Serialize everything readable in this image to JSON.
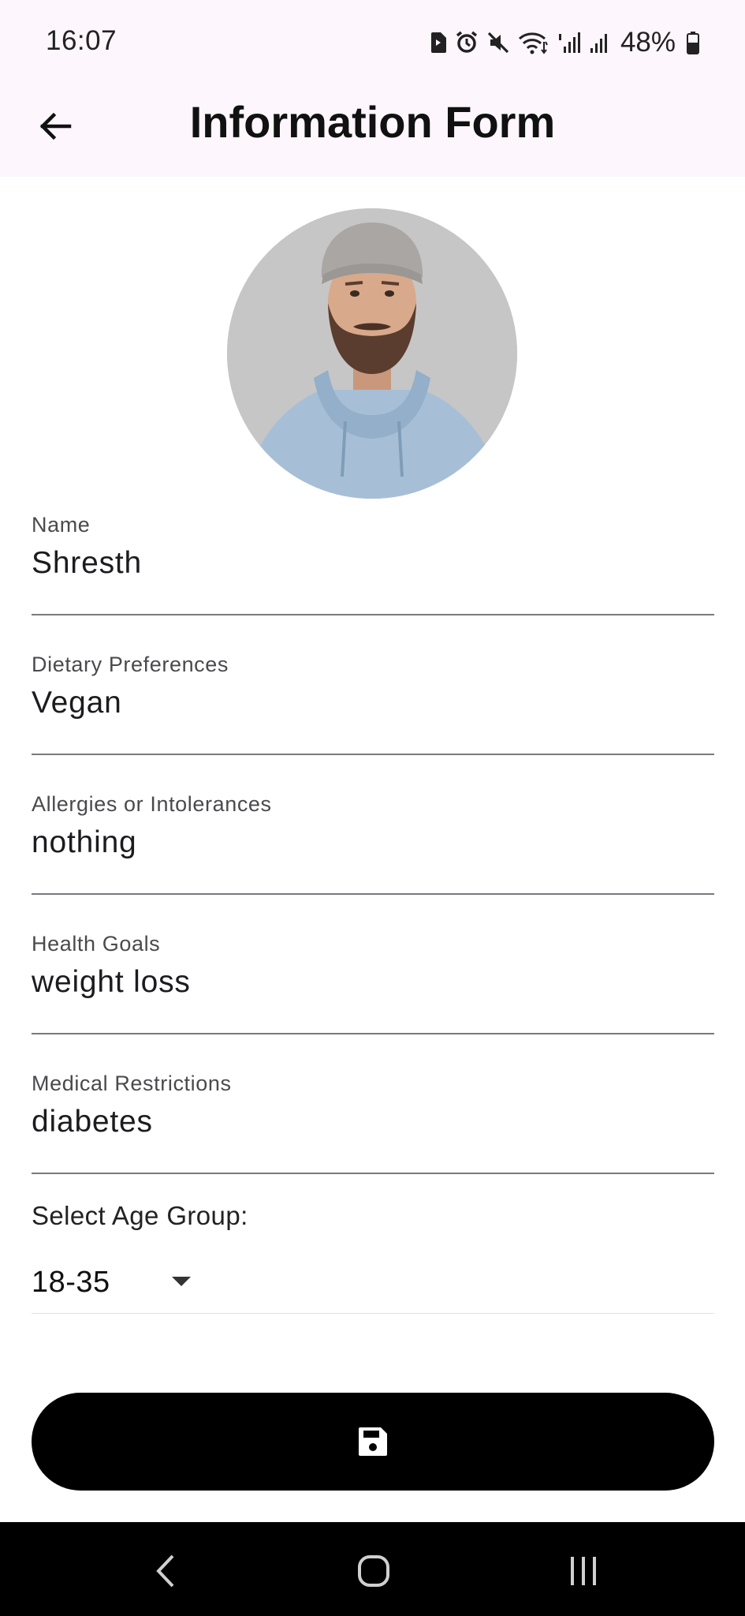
{
  "status_bar": {
    "time": "16:07",
    "battery": "48%",
    "icons": [
      "sim-icon",
      "alarm-icon",
      "mute-icon",
      "wifi-icon",
      "signal-icon",
      "signal-icon",
      "battery-icon"
    ]
  },
  "app_bar": {
    "title": "Information Form",
    "back_icon": "arrow-left-icon"
  },
  "form": {
    "fields": [
      {
        "label": "Name",
        "value": "Shresth"
      },
      {
        "label": "Dietary Preferences",
        "value": "Vegan"
      },
      {
        "label": "Allergies or Intolerances",
        "value": "nothing"
      },
      {
        "label": "Health Goals",
        "value": "weight loss"
      },
      {
        "label": "Medical Restrictions",
        "value": "diabetes"
      }
    ],
    "age_group": {
      "label": "Select Age Group:",
      "selected": "18-35"
    },
    "save_icon": "save-icon"
  },
  "colors": {
    "app_bar_bg": "#fdf6fd",
    "button_bg": "#000000",
    "nav_bar_bg": "#000000"
  }
}
